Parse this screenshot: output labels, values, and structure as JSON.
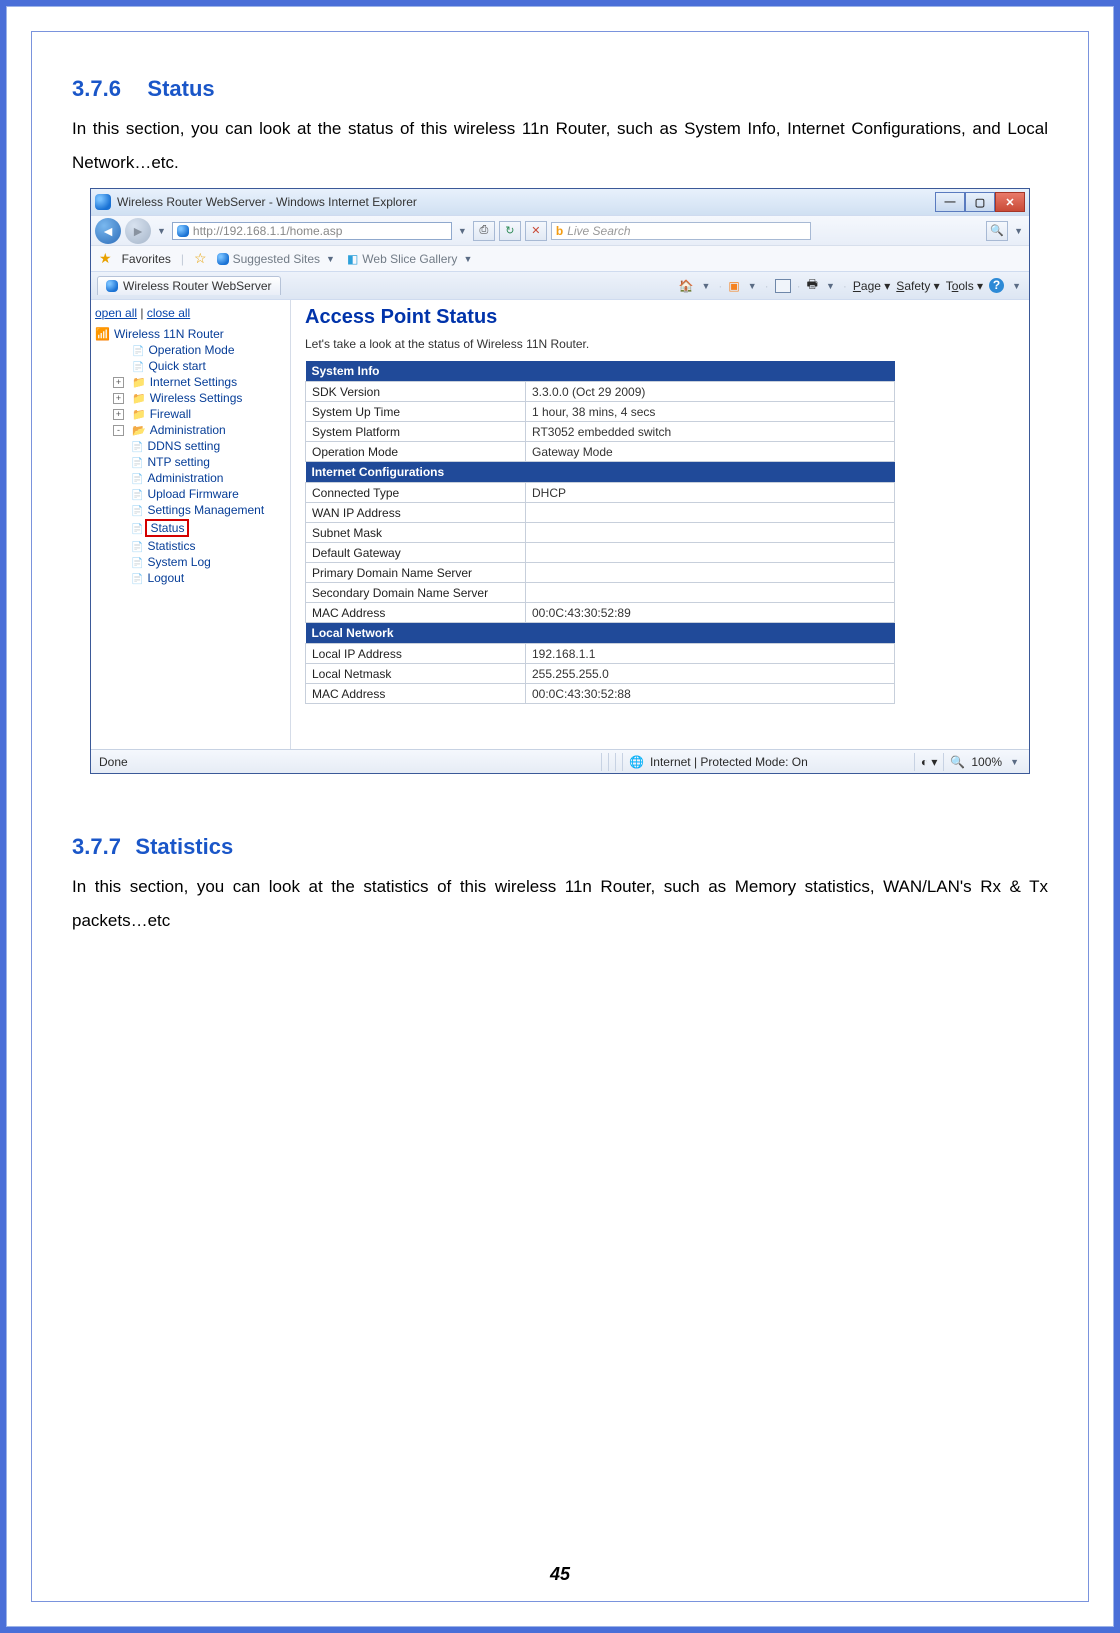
{
  "page_number": "45",
  "section1": {
    "num": "3.7.6",
    "title": "Status"
  },
  "body1": "In this section, you can look at the status of this wireless 11n Router, such as System Info, Internet Configurations, and Local Network…etc.",
  "section2": {
    "num": "3.7.7",
    "title": "Statistics"
  },
  "body2": "In this section, you can look at the statistics of this wireless 11n Router, such as Memory statistics, WAN/LAN's Rx & Tx packets…etc",
  "ie": {
    "title": "Wireless Router WebServer - Windows Internet Explorer",
    "url": "http://192.168.1.1/home.asp",
    "search_placeholder": "Live Search",
    "favorites": "Favorites",
    "suggested": "Suggested Sites",
    "webslice": "Web Slice Gallery",
    "tab": "Wireless Router WebServer",
    "cmdbar": {
      "page": "Page",
      "safety": "Safety",
      "tools": "Tools"
    },
    "status_left": "Done",
    "status_mid": "Internet | Protected Mode: On",
    "zoom": "100%"
  },
  "tree": {
    "open_all": "open all",
    "close_all": "close all",
    "root": "Wireless 11N Router",
    "items": [
      {
        "label": "Operation Mode",
        "indent": 1,
        "type": "file"
      },
      {
        "label": "Quick start",
        "indent": 1,
        "type": "file"
      },
      {
        "label": "Internet Settings",
        "indent": 1,
        "type": "folder",
        "expander": "+"
      },
      {
        "label": "Wireless Settings",
        "indent": 1,
        "type": "folder",
        "expander": "+"
      },
      {
        "label": "Firewall",
        "indent": 1,
        "type": "folder",
        "expander": "+"
      },
      {
        "label": "Administration",
        "indent": 1,
        "type": "folder-open",
        "expander": "-"
      },
      {
        "label": "DDNS setting",
        "indent": 2,
        "type": "file"
      },
      {
        "label": "NTP setting",
        "indent": 2,
        "type": "file"
      },
      {
        "label": "Administration",
        "indent": 2,
        "type": "file"
      },
      {
        "label": "Upload Firmware",
        "indent": 2,
        "type": "file"
      },
      {
        "label": "Settings Management",
        "indent": 2,
        "type": "file"
      },
      {
        "label": "Status",
        "indent": 2,
        "type": "file",
        "highlight": true
      },
      {
        "label": "Statistics",
        "indent": 2,
        "type": "file"
      },
      {
        "label": "System Log",
        "indent": 2,
        "type": "file"
      },
      {
        "label": "Logout",
        "indent": 2,
        "type": "file"
      }
    ]
  },
  "main": {
    "title": "Access Point Status",
    "sub": "Let's take a look at the status of Wireless 11N Router.",
    "sections": [
      {
        "header": "System Info",
        "rows": [
          [
            "SDK Version",
            "3.3.0.0 (Oct 29 2009)"
          ],
          [
            "System Up Time",
            "1 hour, 38 mins, 4 secs"
          ],
          [
            "System Platform",
            "RT3052 embedded switch"
          ],
          [
            "Operation Mode",
            "Gateway Mode"
          ]
        ]
      },
      {
        "header": "Internet Configurations",
        "rows": [
          [
            "Connected Type",
            "DHCP"
          ],
          [
            "WAN IP Address",
            ""
          ],
          [
            "Subnet Mask",
            ""
          ],
          [
            "Default Gateway",
            ""
          ],
          [
            "Primary Domain Name Server",
            ""
          ],
          [
            "Secondary Domain Name Server",
            ""
          ],
          [
            "MAC Address",
            "00:0C:43:30:52:89"
          ]
        ]
      },
      {
        "header": "Local Network",
        "rows": [
          [
            "Local IP Address",
            "192.168.1.1"
          ],
          [
            "Local Netmask",
            "255.255.255.0"
          ],
          [
            "MAC Address",
            "00:0C:43:30:52:88"
          ]
        ]
      }
    ]
  }
}
